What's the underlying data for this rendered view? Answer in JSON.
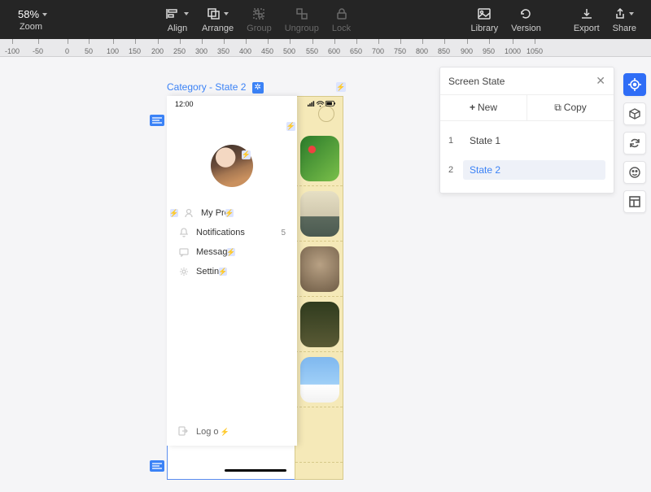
{
  "toolbar": {
    "zoom_value": "58%",
    "zoom_label": "Zoom",
    "align": "Align",
    "arrange": "Arrange",
    "group": "Group",
    "ungroup": "Ungroup",
    "lock": "Lock",
    "library": "Library",
    "version": "Version",
    "export": "Export",
    "share": "Share"
  },
  "ruler": {
    "ticks": [
      "-100",
      "-50",
      "0",
      "50",
      "100",
      "150",
      "200",
      "250",
      "300",
      "350",
      "400",
      "450",
      "500",
      "550",
      "600",
      "650",
      "700",
      "750",
      "800",
      "850",
      "900",
      "950",
      "1000",
      "1050"
    ]
  },
  "artboard": {
    "title": "Category - State 2",
    "statusbar": {
      "time": "12:00"
    },
    "menu": {
      "items": [
        {
          "label": "My Prof",
          "badge": ""
        },
        {
          "label": "Notifications",
          "badge": "5"
        },
        {
          "label": "Messag",
          "badge": ""
        },
        {
          "label": "Settin",
          "badge": ""
        }
      ],
      "logout": "Log o"
    }
  },
  "panel": {
    "title": "Screen State",
    "new": "New",
    "copy": "Copy",
    "states": [
      {
        "num": "1",
        "label": "State 1",
        "active": false
      },
      {
        "num": "2",
        "label": "State 2",
        "active": true
      }
    ]
  }
}
